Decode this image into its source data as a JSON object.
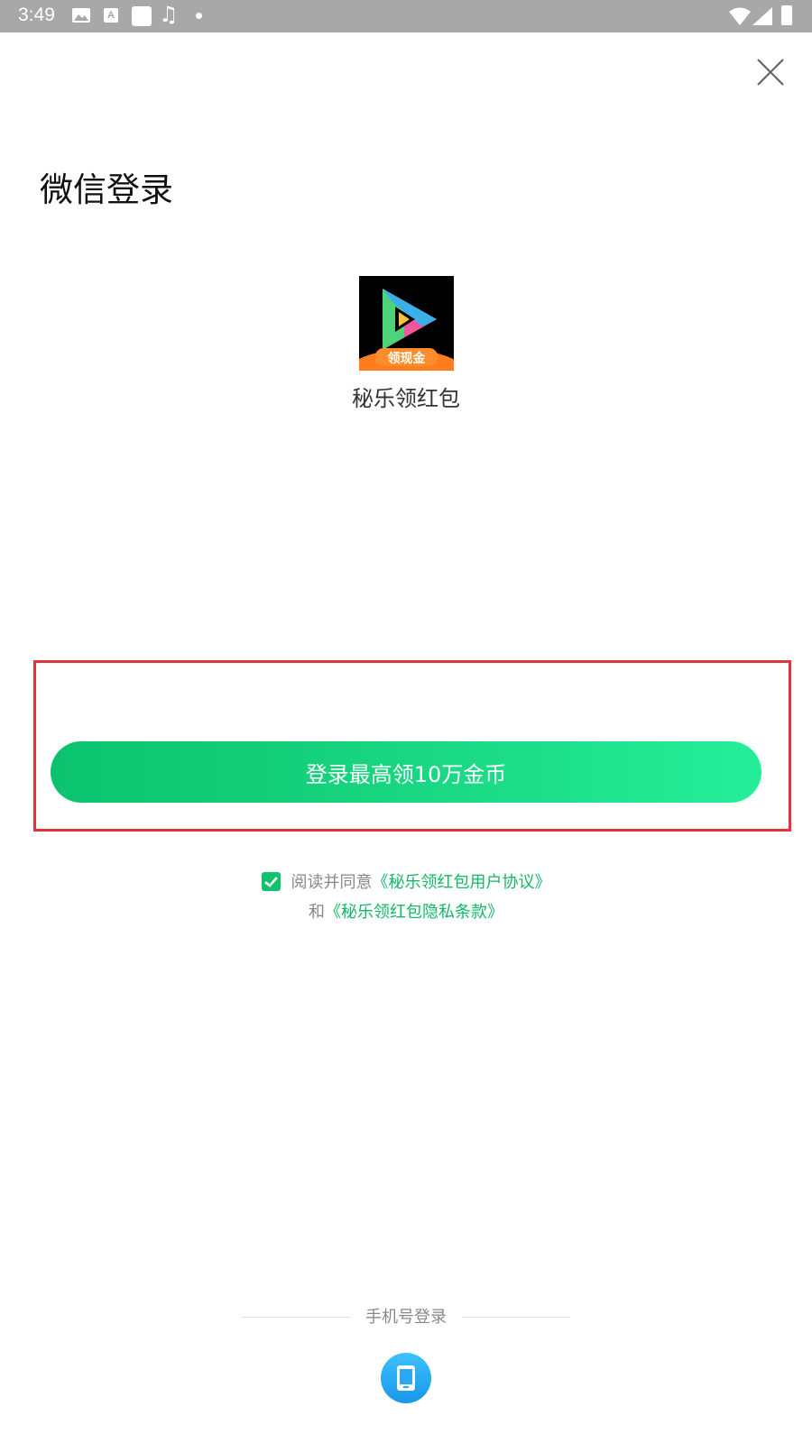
{
  "status_bar": {
    "time": "3:49",
    "icons": [
      "image-icon",
      "a-icon",
      "square-icon",
      "music-icon",
      "dot-icon",
      "wifi-icon",
      "signal-icon",
      "battery-icon"
    ]
  },
  "header": {
    "close_icon": "close-icon",
    "title": "微信登录"
  },
  "app": {
    "icon_badge": "领现金",
    "name": "秘乐领红包"
  },
  "login": {
    "button_label": "登录最高领10万金币",
    "highlight_color": "#e0343a",
    "button_colors": [
      "#0cc26e",
      "#25ee9a"
    ]
  },
  "agreement": {
    "checked": true,
    "prefix": "阅读并同意",
    "user_agreement": "《秘乐领红包用户协议》",
    "and": "和",
    "privacy_policy": "《秘乐领红包隐私条款》",
    "link_color": "#12b866"
  },
  "alt_login": {
    "label": "手机号登录",
    "icon": "phone-icon"
  }
}
